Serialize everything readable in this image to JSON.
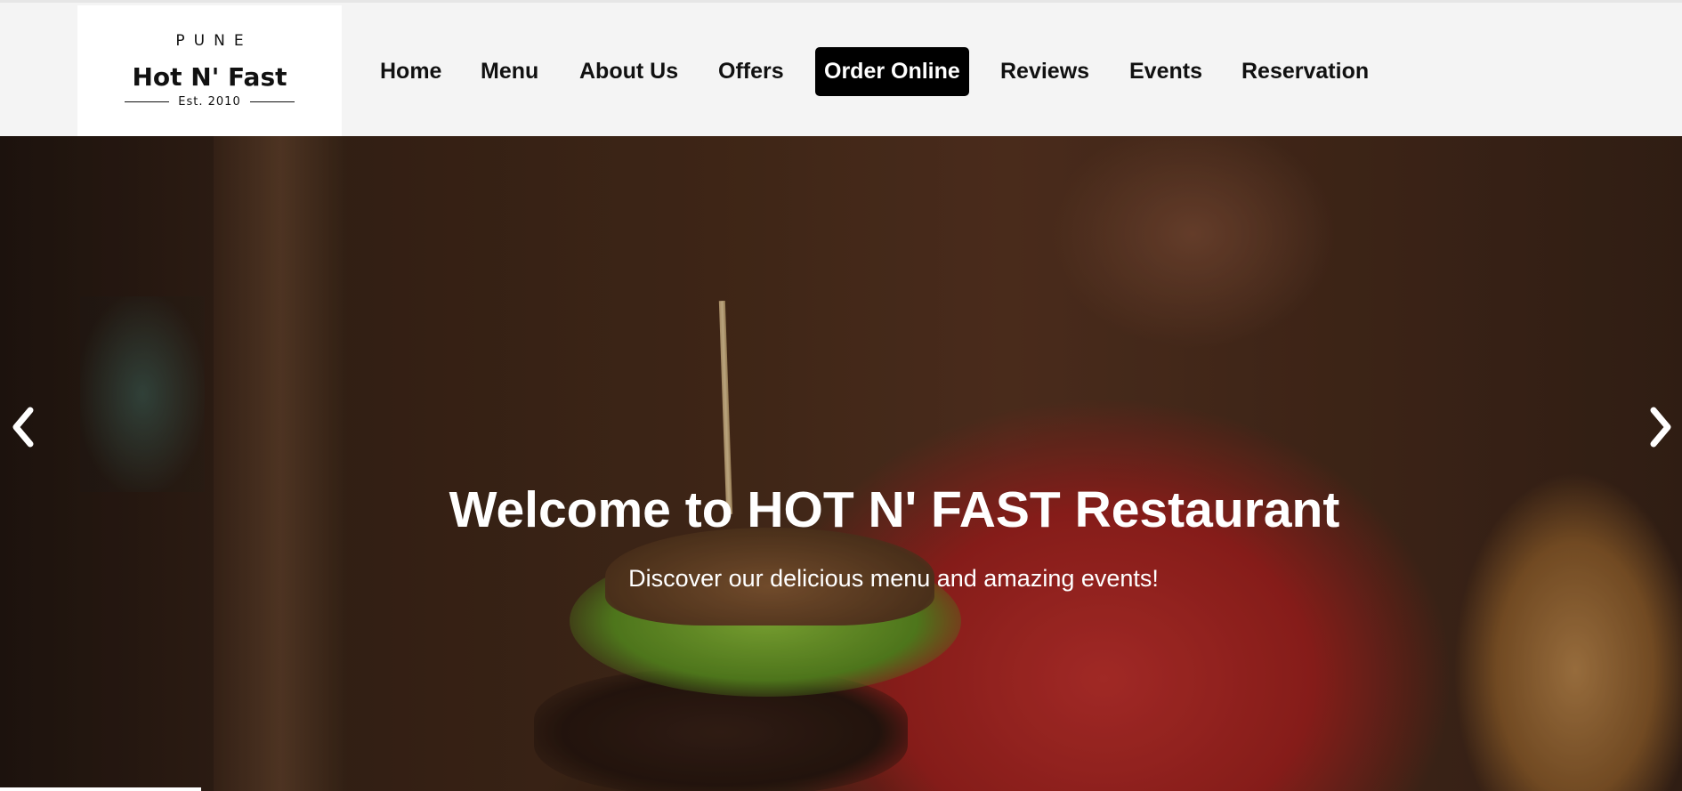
{
  "logo": {
    "city": "PUNE",
    "name": "Hot N' Fast",
    "established": "Est. 2010"
  },
  "nav": {
    "items": [
      {
        "label": "Home"
      },
      {
        "label": "Menu"
      },
      {
        "label": "About Us"
      },
      {
        "label": "Offers"
      },
      {
        "label": "Order Online",
        "active": true
      },
      {
        "label": "Reviews"
      },
      {
        "label": "Events"
      },
      {
        "label": "Reservation"
      }
    ]
  },
  "hero": {
    "title": "Welcome to HOT N' FAST Restaurant",
    "subtitle": "Discover our delicious menu and amazing events!",
    "prev_icon": "chevron-left-icon",
    "next_icon": "chevron-right-icon"
  },
  "colors": {
    "topbar_bg": "#f4f4f4",
    "active_nav_bg": "#000000",
    "hero_text": "#ffffff"
  }
}
